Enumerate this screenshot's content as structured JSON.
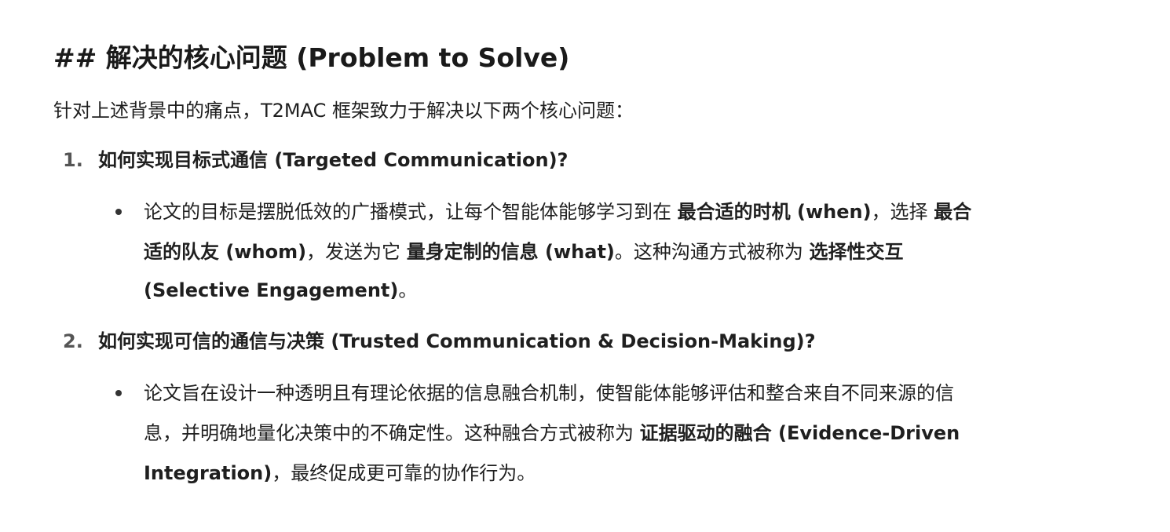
{
  "heading": "## 解决的核心问题 (Problem to Solve)",
  "intro": "针对上述背景中的痛点，T2MAC 框架致力于解决以下两个核心问题：",
  "items": [
    {
      "number": "1.",
      "title": "如何实现目标式通信 (Targeted Communication)?",
      "bullet": {
        "line1": {
          "a": "论文的目标是摆脱低效的广播模式，让每个智能体能够学习到在 ",
          "b": "最合适的时机 (when)",
          "c": "，选择 ",
          "d": "最合"
        },
        "line2": {
          "a": "适的队友 (whom)",
          "b": "，发送为它 ",
          "c": "量身定制的信息 (what)",
          "d": "。这种沟通方式被称为 ",
          "e": "选择性交互"
        },
        "line3": {
          "a": "(Selective Engagement)",
          "b": "。"
        }
      }
    },
    {
      "number": "2.",
      "title": "如何实现可信的通信与决策 (Trusted Communication & Decision-Making)?",
      "bullet": {
        "line1": "论文旨在设计一种透明且有理论依据的信息融合机制，使智能体能够评估和整合来自不同来源的信",
        "line2": {
          "a": "息，并明确地量化决策中的不确定性。这种融合方式被称为 ",
          "b": "证据驱动的融合 (Evidence-Driven"
        },
        "line3": {
          "a": "Integration)",
          "b": "，最终促成更可靠的协作行为。"
        }
      }
    }
  ]
}
